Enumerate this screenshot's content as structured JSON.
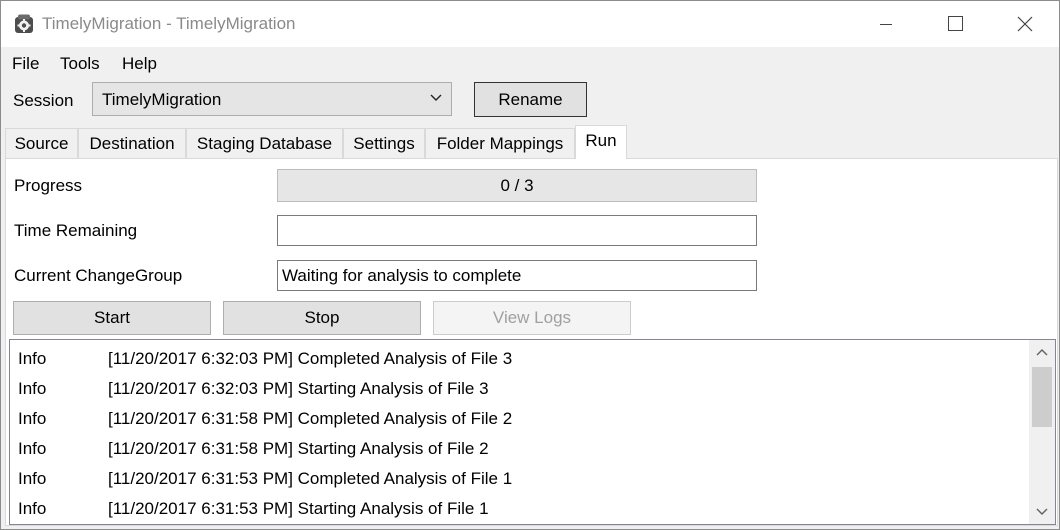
{
  "window": {
    "title": "TimelyMigration - TimelyMigration",
    "icon": "app-gear-icon"
  },
  "menu": {
    "items": [
      "File",
      "Tools",
      "Help"
    ]
  },
  "session": {
    "label": "Session",
    "value": "TimelyMigration",
    "rename_label": "Rename"
  },
  "tabs": [
    {
      "label": "Source"
    },
    {
      "label": "Destination"
    },
    {
      "label": "Staging Database"
    },
    {
      "label": "Settings"
    },
    {
      "label": "Folder Mappings"
    },
    {
      "label": "Run",
      "active": true
    }
  ],
  "run": {
    "progress_label": "Progress",
    "progress_text": "0 / 3",
    "progress_fraction": 0,
    "time_remaining_label": "Time Remaining",
    "time_remaining_value": "",
    "change_group_label": "Current ChangeGroup",
    "change_group_value": "Waiting for analysis to complete",
    "start_label": "Start",
    "stop_label": "Stop",
    "view_logs_label": "View Logs"
  },
  "logs": [
    {
      "level": "Info",
      "message": "[11/20/2017 6:32:03 PM] Completed Analysis of File 3"
    },
    {
      "level": "Info",
      "message": "[11/20/2017 6:32:03 PM] Starting Analysis of File 3"
    },
    {
      "level": "Info",
      "message": "[11/20/2017 6:31:58 PM] Completed Analysis of File 2"
    },
    {
      "level": "Info",
      "message": "[11/20/2017 6:31:58 PM] Starting Analysis of File 2"
    },
    {
      "level": "Info",
      "message": "[11/20/2017 6:31:53 PM] Completed Analysis of File 1"
    },
    {
      "level": "Info",
      "message": "[11/20/2017 6:31:53 PM] Starting Analysis of File 1"
    }
  ]
}
